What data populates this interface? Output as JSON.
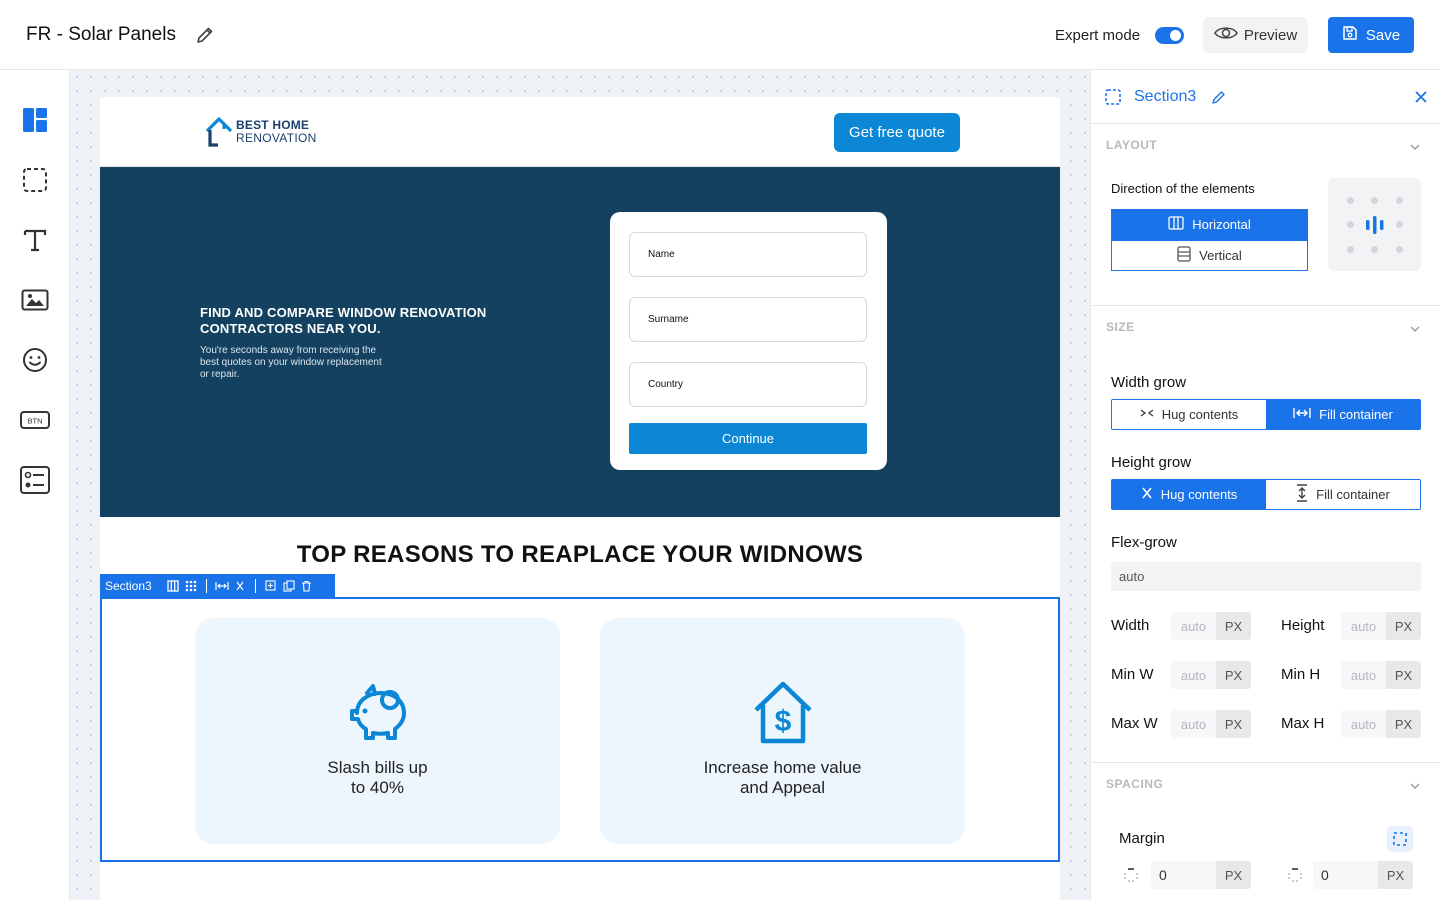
{
  "topbar": {
    "doc_title": "FR - Solar Panels",
    "expert_mode_label": "Expert mode",
    "expert_mode_on": true,
    "preview_label": "Preview",
    "save_label": "Save",
    "accent_color": "#1a73e8"
  },
  "left_tools": [
    {
      "icon": "layout-icon"
    },
    {
      "icon": "section-icon"
    },
    {
      "icon": "text-icon"
    },
    {
      "icon": "image-icon"
    },
    {
      "icon": "emoji-icon"
    },
    {
      "icon": "button-icon",
      "label": "BTN"
    },
    {
      "icon": "form-icon"
    }
  ],
  "site": {
    "logo_line1": "BEST HOME",
    "logo_line2": "RENOVATION",
    "quote_button": "Get free quote",
    "hero_title": "FIND AND COMPARE WINDOW RENOVATION CONTRACTORS NEAR YOU.",
    "hero_subtitle": "You're seconds away from receiving the best quotes on your window replacement or repair.",
    "form": {
      "fields": [
        "Name",
        "Surname",
        "Country"
      ],
      "continue_label": "Continue"
    },
    "reasons_title": "TOP REASONS TO REAPLACE YOUR WIDNOWS",
    "selected_section_label": "Section3",
    "features": [
      {
        "icon": "piggy-bank-icon",
        "text": "Slash bills up\nto 40%"
      },
      {
        "icon": "house-dollar-icon",
        "text": "Increase home value\nand Appeal"
      }
    ]
  },
  "panel": {
    "title": "Section3",
    "layout": {
      "label": "LAYOUT",
      "direction_label": "Direction of the elements",
      "horizontal_label": "Horizontal",
      "vertical_label": "Vertical",
      "selected": "Horizontal"
    },
    "size": {
      "label": "SIZE",
      "width_grow_label": "Width grow",
      "width_grow_options": [
        "Hug contents",
        "Fill container"
      ],
      "width_grow_selected": "Fill container",
      "height_grow_label": "Height grow",
      "height_grow_options": [
        "Hug contents",
        "Fill container"
      ],
      "height_grow_selected": "Hug contents",
      "flex_grow_label": "Flex-grow",
      "flex_grow_value": "auto",
      "dims": [
        {
          "label": "Width",
          "value": "auto",
          "unit": "PX"
        },
        {
          "label": "Height",
          "value": "auto",
          "unit": "PX"
        },
        {
          "label": "Min W",
          "value": "auto",
          "unit": "PX"
        },
        {
          "label": "Min H",
          "value": "auto",
          "unit": "PX"
        },
        {
          "label": "Max W",
          "value": "auto",
          "unit": "PX"
        },
        {
          "label": "Max H",
          "value": "auto",
          "unit": "PX"
        }
      ]
    },
    "spacing": {
      "label": "SPACING",
      "margin_label": "Margin",
      "margin_values": [
        {
          "value": "0",
          "unit": "PX"
        },
        {
          "value": "0",
          "unit": "PX"
        }
      ]
    }
  }
}
